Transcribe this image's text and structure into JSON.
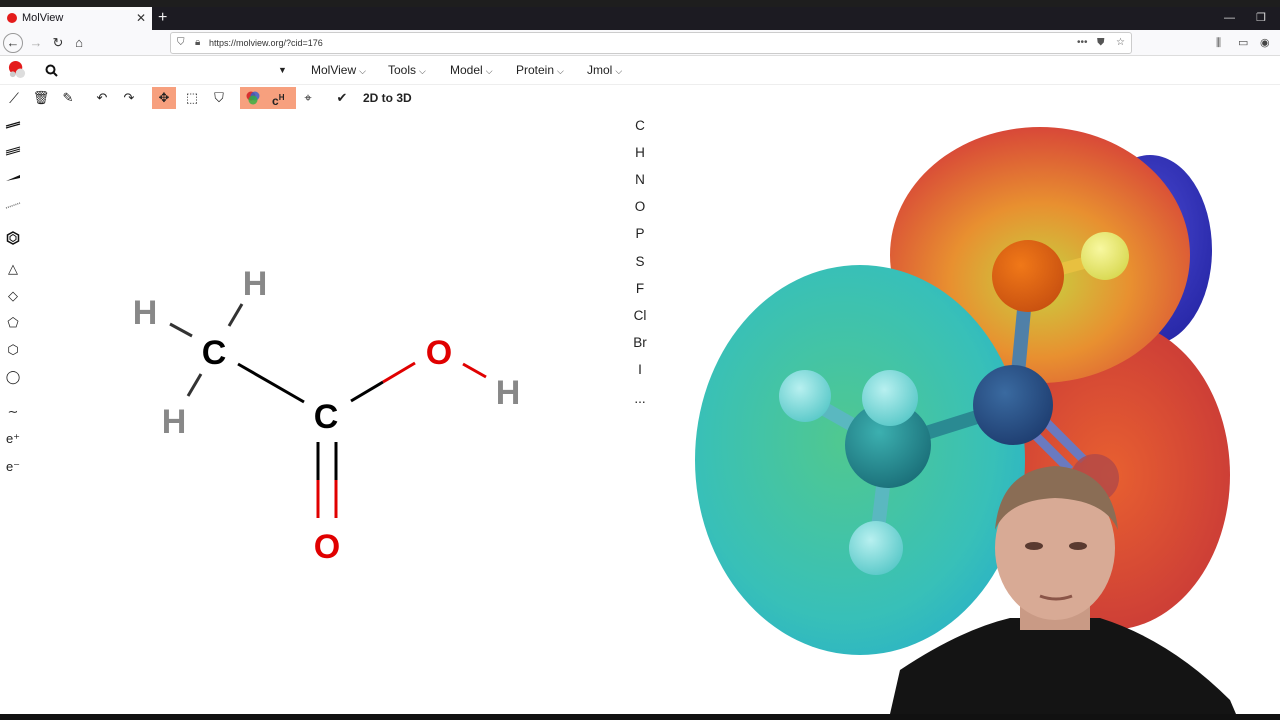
{
  "browser": {
    "tab_title": "MolView",
    "tab_close": "✕",
    "new_tab": "+",
    "url": "https://molview.org/?cid=176"
  },
  "app": {
    "menus": [
      {
        "label": "MolView"
      },
      {
        "label": "Tools"
      },
      {
        "label": "Model"
      },
      {
        "label": "Protein"
      },
      {
        "label": "Jmol"
      }
    ],
    "to3d_label": "2D to 3D",
    "elements": [
      "C",
      "H",
      "N",
      "O",
      "P",
      "S",
      "F",
      "Cl",
      "Br",
      "I",
      "..."
    ],
    "left_tools": {
      "e_plus": "e⁺",
      "e_minus": "e⁻"
    }
  },
  "molecule_2d": {
    "atoms": [
      {
        "label": "H",
        "color": "#888888"
      },
      {
        "label": "H",
        "color": "#888888"
      },
      {
        "label": "C",
        "color": "#000000"
      },
      {
        "label": "H",
        "color": "#888888"
      },
      {
        "label": "C",
        "color": "#000000"
      },
      {
        "label": "O",
        "color": "#e00000"
      },
      {
        "label": "H",
        "color": "#888888"
      },
      {
        "label": "O",
        "color": "#e00000"
      }
    ]
  },
  "colors": {
    "toolbar_active": "#f7a07e",
    "carbon": "#000000",
    "hydrogen": "#888888",
    "oxygen": "#e00000"
  }
}
